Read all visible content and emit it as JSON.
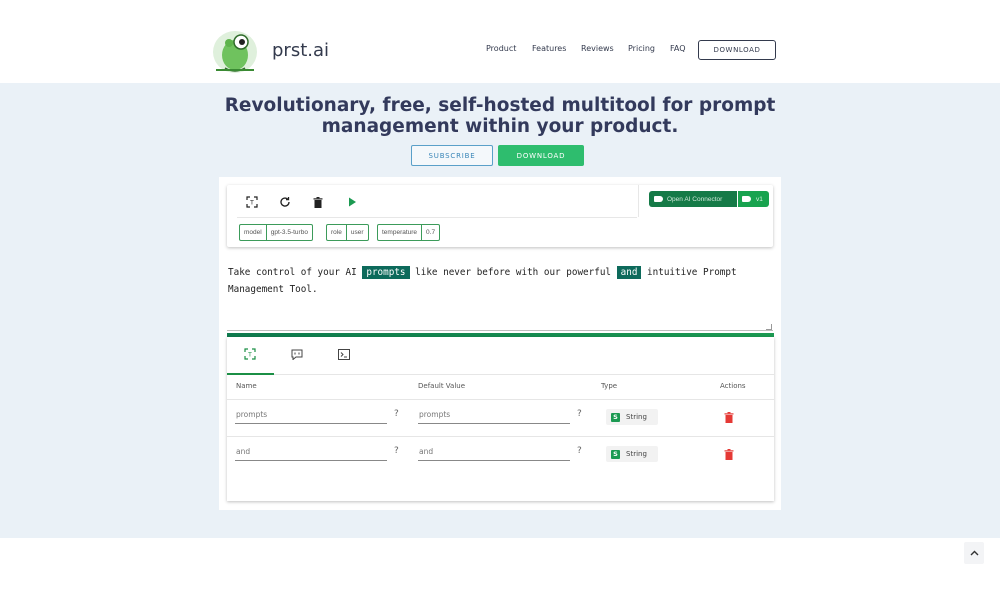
{
  "header": {
    "brand": "prst.ai",
    "nav": [
      "Product",
      "Features",
      "Reviews",
      "Pricing",
      "FAQ"
    ],
    "download_label": "DOWNLOAD"
  },
  "hero": {
    "title_line1": "Revolutionary, free, self-hosted multitool for prompt",
    "title_line2": "management within your product.",
    "subscribe_label": "SUBSCRIBE",
    "download_label": "DOWNLOAD"
  },
  "toolbar": {
    "icons": [
      "focus-icon",
      "refresh-icon",
      "trash-icon",
      "play-icon"
    ],
    "chips": [
      {
        "key": "model",
        "value": "gpt-3.5-turbo"
      },
      {
        "key": "role",
        "value": "user"
      },
      {
        "key": "temperature",
        "value": "0.7"
      }
    ],
    "connector_label": "Open AI Connector",
    "version_label": "v1"
  },
  "prompt": {
    "part1": "Take control of your AI ",
    "var1": "prompts",
    "part2": " like never before with our powerful ",
    "var2": "and",
    "part3": " intuitive Prompt",
    "line2": "Management Tool."
  },
  "variables": {
    "tabs": [
      "variables-tab-icon",
      "chat-tab-icon",
      "terminal-tab-icon"
    ],
    "columns": [
      "Name",
      "Default Value",
      "Type",
      "Actions"
    ],
    "rows": [
      {
        "name": "prompts",
        "default": "prompts",
        "type": "String",
        "type_badge": "S"
      },
      {
        "name": "and",
        "default": "and",
        "type": "String",
        "type_badge": "S"
      }
    ],
    "help_mark": "?"
  },
  "colors": {
    "accent_green": "#2ebd6e",
    "highlight": "#0d6a5b",
    "title": "#333a5c",
    "delete_red": "#e53935"
  }
}
